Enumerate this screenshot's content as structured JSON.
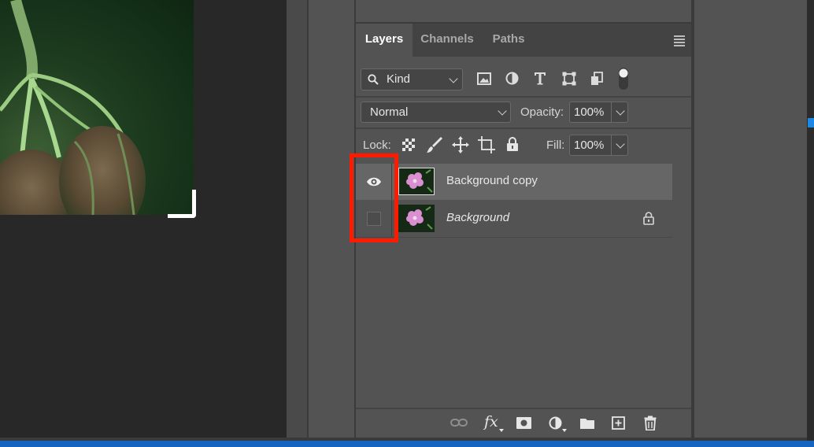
{
  "canvas": {
    "image": "flower-bud-photo"
  },
  "layers_panel": {
    "tabs": [
      {
        "label": "Layers",
        "active": true
      },
      {
        "label": "Channels",
        "active": false
      },
      {
        "label": "Paths",
        "active": false
      }
    ],
    "filter": {
      "kind_label": "Kind",
      "icons": [
        "image-filter-icon",
        "adjustment-filter-icon",
        "type-filter-icon",
        "shape-filter-icon",
        "smart-object-filter-icon",
        "filter-toggle-icon"
      ]
    },
    "blend_mode": "Normal",
    "opacity_label": "Opacity:",
    "opacity_value": "100%",
    "lock_label": "Lock:",
    "lock_icons": [
      "lock-transparent-pixels-icon",
      "lock-image-pixels-icon",
      "lock-position-icon",
      "lock-artboard-icon",
      "lock-all-icon"
    ],
    "fill_label": "Fill:",
    "fill_value": "100%",
    "layers": [
      {
        "name": "Background copy",
        "visible": true,
        "selected": true,
        "locked": false
      },
      {
        "name": "Background",
        "visible": false,
        "selected": false,
        "locked": true
      }
    ],
    "footer_icons": [
      "link-layers-icon",
      "fx-icon",
      "add-mask-icon",
      "new-adjustment-icon",
      "new-group-icon",
      "new-layer-icon",
      "delete-layer-icon"
    ]
  },
  "colors": {
    "highlight": "#ff1a00",
    "panel_bg": "#535353",
    "selected_row": "#666666"
  }
}
